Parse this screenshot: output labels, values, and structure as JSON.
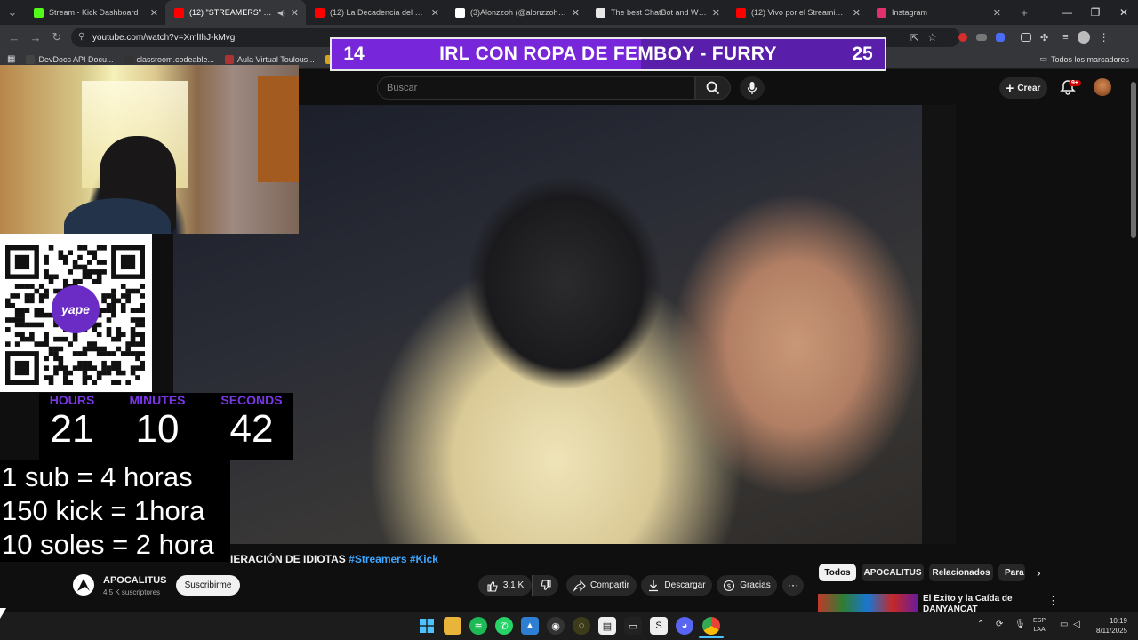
{
  "browser": {
    "tabs": [
      {
        "label": "Stream - Kick Dashboard",
        "favicon_color": "#53fc18",
        "active": false
      },
      {
        "label": "(12) \"STREAMERS\" LA NUEVA",
        "favicon_color": "#ff0000",
        "active": true
      },
      {
        "label": "(12) La Decadencia del Streami",
        "favicon_color": "#ff0000",
        "active": false
      },
      {
        "label": "(3)Alonzzoh (@alonzzoh) | TikT",
        "favicon_color": "#ffffff",
        "active": false
      },
      {
        "label": "The best ChatBot and Widgets",
        "favicon_color": "#e8e8e8",
        "active": false
      },
      {
        "label": "(12) Vivo por el Streaming - Yo",
        "favicon_color": "#ff0000",
        "active": false
      },
      {
        "label": "Instagram",
        "favicon_color": "#e1306c",
        "active": false
      }
    ],
    "url": "youtube.com/watch?v=XmlIhJ-kMvg",
    "bookmarks": [
      {
        "label": "DevDocs API Docu...",
        "color": "#444"
      },
      {
        "label": "classroom.codeable...",
        "color": "#333"
      },
      {
        "label": "Aula Virtual Toulous...",
        "color": "#a33"
      },
      {
        "label": "Po",
        "color": "#d4a21b"
      }
    ],
    "all_bookmarks": "Todos los marcadores"
  },
  "overlay": {
    "goal_current": "14",
    "goal_text": "IRL CON ROPA DE FEMBOY - FURRY",
    "goal_target": "25",
    "goal_progress": 0.56,
    "timer": {
      "hours_label": "HOURS",
      "hours": "21",
      "minutes_label": "MINUTES",
      "minutes": "10",
      "seconds_label": "SECONDS",
      "seconds": "42"
    },
    "rules": [
      "1 sub = 4 horas",
      "150 kick = 1hora",
      "10 soles = 2 hora"
    ],
    "qr_logo": "yape"
  },
  "youtube": {
    "search_placeholder": "Buscar",
    "create_label": "Crear",
    "notifications_badge": "9+",
    "video_title": "IERACIÓN DE IDIOTAS",
    "hashtags": [
      "#Streamers",
      "#Kick"
    ],
    "channel": {
      "name": "APOCALITUS",
      "subscribers": "4,5 K suscriptores"
    },
    "subscribe_label": "Suscribirme",
    "likes": "3,1 K",
    "share_label": "Compartir",
    "download_label": "Descargar",
    "thanks_label": "Gracias",
    "chips": [
      "Todos",
      "APOCALITUS",
      "Relacionados",
      "Para"
    ],
    "recommended_title": "El Éxito y la Caída de DANYANCAT"
  },
  "taskbar": {
    "lang_line1": "ESP",
    "lang_line2": "LAA",
    "time": "10:19",
    "date": "8/11/2025"
  }
}
